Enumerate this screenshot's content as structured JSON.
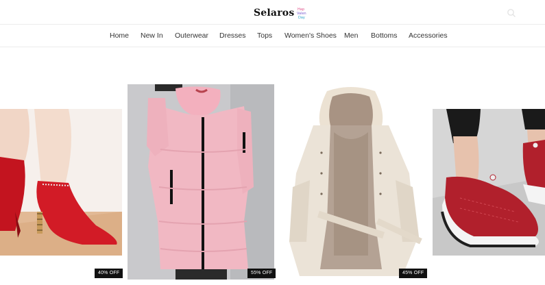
{
  "brand": {
    "name": "Selaros",
    "badge_text": "Happy Valentine's Day"
  },
  "nav": {
    "items": [
      {
        "label": "Home"
      },
      {
        "label": "New In"
      },
      {
        "label": "Outerwear"
      },
      {
        "label": "Dresses"
      },
      {
        "label": "Tops"
      },
      {
        "label": "Women's Shoes"
      },
      {
        "label": "Men"
      },
      {
        "label": "Bottoms"
      },
      {
        "label": "Accessories"
      }
    ]
  },
  "products": [
    {
      "name": "red-ankle-boots",
      "discount": "40% OFF"
    },
    {
      "name": "pink-puffer-coat",
      "discount": "55% OFF"
    },
    {
      "name": "fur-lined-parka",
      "discount": "45% OFF"
    },
    {
      "name": "red-knit-sneakers",
      "discount": ""
    }
  ],
  "colors": {
    "accent": "#111111",
    "nav_text": "#333333",
    "divider": "#ececec"
  },
  "icons": {
    "search": "search-icon"
  }
}
